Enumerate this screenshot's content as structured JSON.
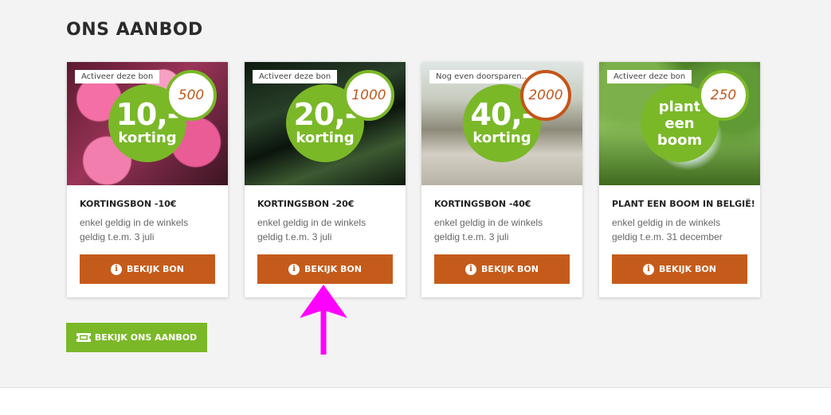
{
  "section": {
    "title": "ONS AANBOD"
  },
  "offers": [
    {
      "tag": "Activeer deze bon",
      "badge_big": "10,-",
      "badge_small": "korting",
      "points": "500",
      "name": "KORTINGSBON -10€",
      "line1": "enkel geldig in de winkels",
      "line2": "geldig t.e.m. 3 juli",
      "button": "BEKIJK BON"
    },
    {
      "tag": "Activeer deze bon",
      "badge_big": "20,-",
      "badge_small": "korting",
      "points": "1000",
      "name": "KORTINGSBON -20€",
      "line1": "enkel geldig in de winkels",
      "line2": "geldig t.e.m. 3 juli",
      "button": "BEKIJK BON"
    },
    {
      "tag": "Nog even doorsparen...",
      "badge_big": "40,-",
      "badge_small": "korting",
      "points": "2000",
      "name": "KORTINGSBON -40€",
      "line1": "enkel geldig in de winkels",
      "line2": "geldig t.e.m. 3 juli",
      "button": "BEKIJK BON"
    },
    {
      "tag": "Activeer deze bon",
      "badge_l1": "plant",
      "badge_l2": "een",
      "badge_l3": "boom",
      "points": "250",
      "name": "PLANT EEN BOOM IN BELGIË!",
      "line1": "enkel geldig in de winkels",
      "line2": "geldig t.e.m. 31 december",
      "button": "BEKIJK BON"
    }
  ],
  "all_offers_button": "BEKIJK ONS AANBOD",
  "colors": {
    "green": "#7ab828",
    "orange": "#c55b1a",
    "annotation": "#ff00ff"
  },
  "icons": {
    "info": "info-circle-icon",
    "ticket": "ticket-icon",
    "annotation": "arrow-up-icon"
  }
}
